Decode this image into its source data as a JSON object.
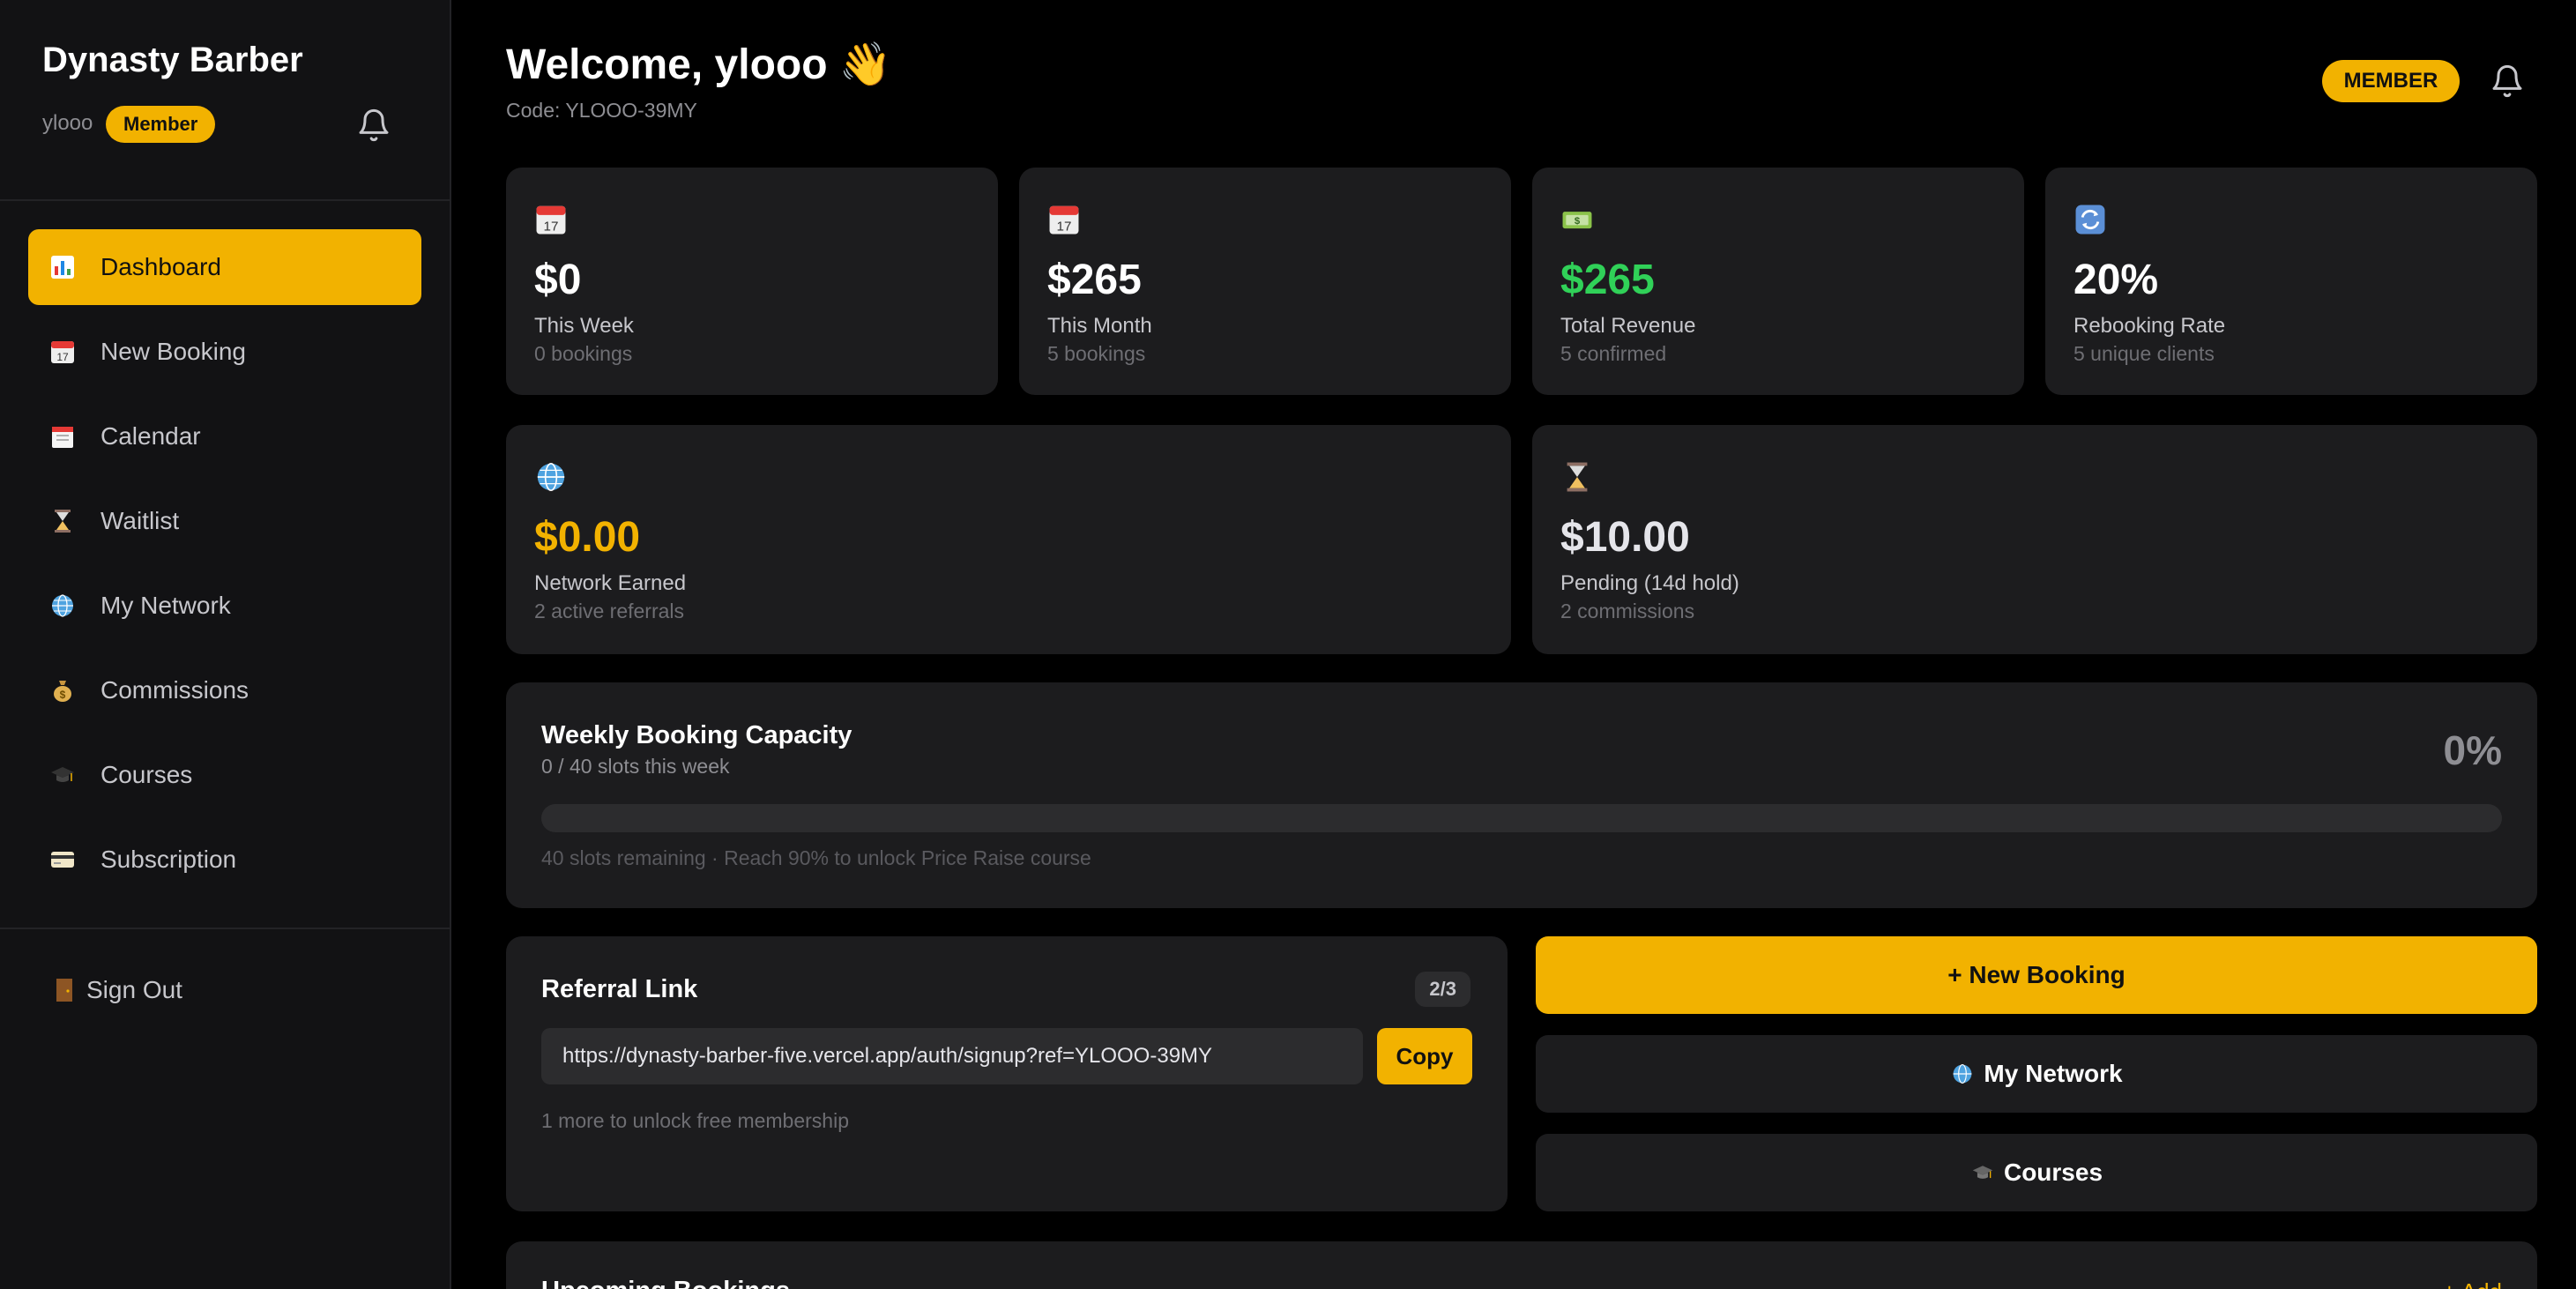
{
  "sidebar": {
    "brand": "Dynasty Barber",
    "username": "ylooo",
    "role_badge": "Member",
    "nav": [
      {
        "label": "Dashboard",
        "icon": "bar-chart-icon",
        "active": true
      },
      {
        "label": "New Booking",
        "icon": "calendar-icon"
      },
      {
        "label": "Calendar",
        "icon": "spiral-calendar-icon"
      },
      {
        "label": "Waitlist",
        "icon": "hourglass-icon"
      },
      {
        "label": "My Network",
        "icon": "globe-icon"
      },
      {
        "label": "Commissions",
        "icon": "money-bag-icon"
      },
      {
        "label": "Courses",
        "icon": "graduation-cap-icon"
      },
      {
        "label": "Subscription",
        "icon": "credit-card-icon"
      }
    ],
    "sign_out": "Sign Out"
  },
  "header": {
    "welcome": "Welcome, ylooo 👋",
    "code": "Code: YLOOO-39MY",
    "badge": "MEMBER"
  },
  "stats": [
    {
      "icon": "calendar-icon",
      "value": "$0",
      "label": "This Week",
      "sub": "0 bookings"
    },
    {
      "icon": "calendar-icon",
      "value": "$265",
      "label": "This Month",
      "sub": "5 bookings"
    },
    {
      "icon": "cash-icon",
      "value": "$265",
      "label": "Total Revenue",
      "sub": "5 confirmed",
      "color": "#30d158"
    },
    {
      "icon": "repeat-icon",
      "value": "20%",
      "label": "Rebooking Rate",
      "sub": "5 unique clients"
    }
  ],
  "network": {
    "earned": {
      "icon": "globe-icon",
      "value": "$0.00",
      "label": "Network Earned",
      "sub": "2 active referrals",
      "color": "#f2b200"
    },
    "pending": {
      "icon": "hourglass-icon",
      "value": "$10.00",
      "label": "Pending (14d hold)",
      "sub": "2 commissions"
    }
  },
  "capacity": {
    "title": "Weekly Booking Capacity",
    "sub": "0 / 40 slots this week",
    "percent_label": "0%",
    "fill_fraction": 0,
    "note": "40 slots remaining · Reach 90% to unlock Price Raise course"
  },
  "referral": {
    "title": "Referral Link",
    "count": "2/3",
    "url": "https://dynasty-barber-five.vercel.app/auth/signup?ref=YLOOO-39MY",
    "copy_label": "Copy",
    "note": "1 more to unlock free membership"
  },
  "actions": {
    "new_booking": "+ New Booking",
    "my_network": "My Network",
    "courses": "Courses"
  },
  "upcoming": {
    "title": "Upcoming Bookings",
    "add": "+ Add"
  },
  "colors": {
    "accent": "#f2b200",
    "green": "#30d158",
    "card": "#1c1c1e",
    "sidebar": "#121214"
  }
}
